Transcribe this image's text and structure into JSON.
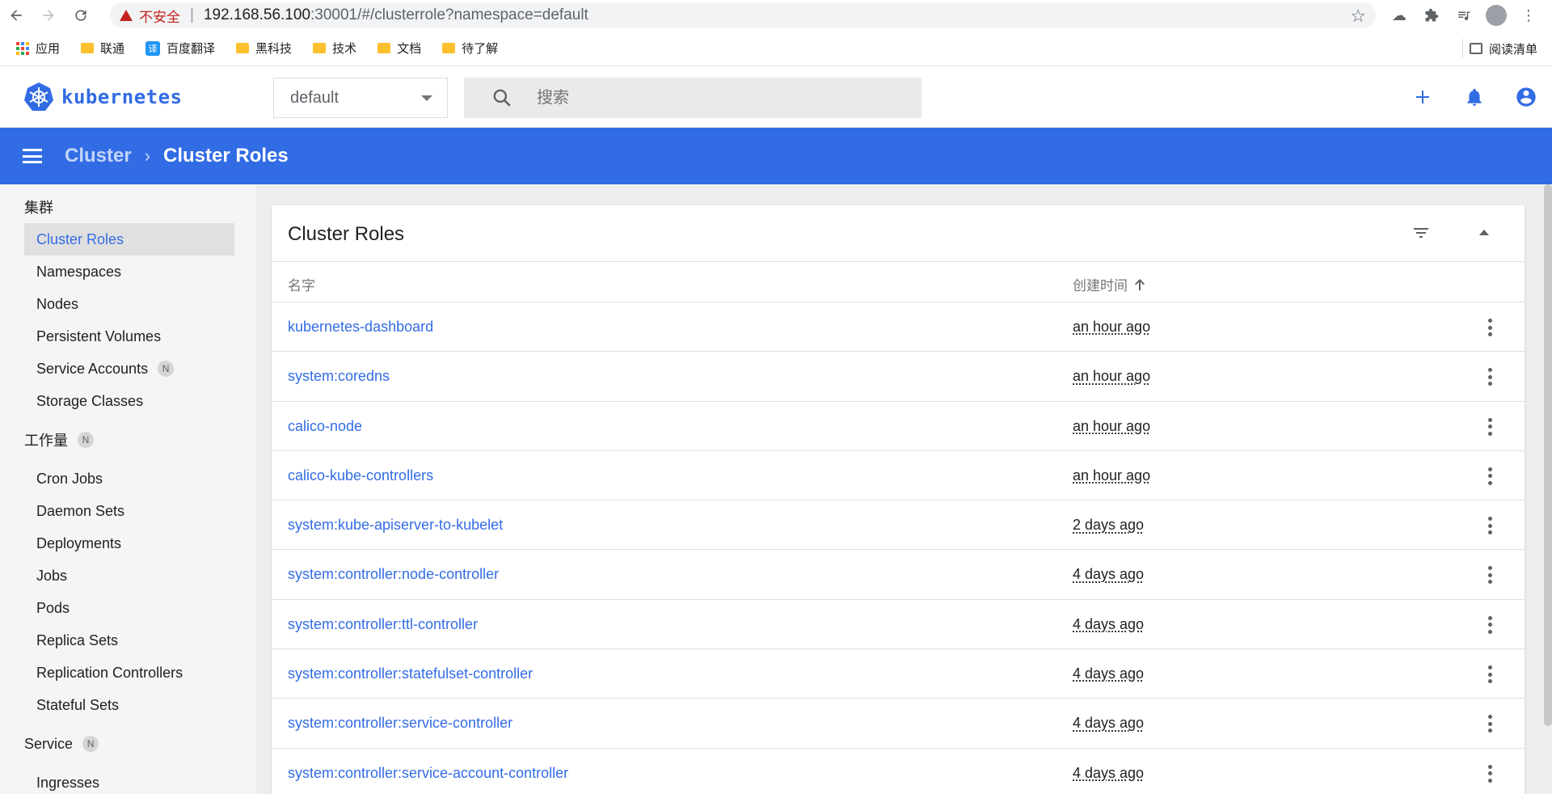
{
  "browser": {
    "warning": "不安全",
    "url_host": "192.168.56.100",
    "url_rest": ":30001/#/clusterrole?namespace=default"
  },
  "bookmarks": {
    "items": [
      "应用",
      "联通",
      "百度翻译",
      "黑科技",
      "技术",
      "文档",
      "待了解"
    ],
    "fanyi_glyph": "译",
    "reading_list": "阅读清单"
  },
  "header": {
    "logo_text": "kubernetes",
    "namespace": "default",
    "search_placeholder": "搜索"
  },
  "toolbar": {
    "crumb_parent": "Cluster",
    "crumb_current": "Cluster Roles"
  },
  "sidebar": {
    "cluster_heading": "集群",
    "cluster_items": [
      "Cluster Roles",
      "Namespaces",
      "Nodes",
      "Persistent Volumes",
      "Service Accounts",
      "Storage Classes"
    ],
    "workloads_heading": "工作量",
    "workload_items": [
      "Cron Jobs",
      "Daemon Sets",
      "Deployments",
      "Jobs",
      "Pods",
      "Replica Sets",
      "Replication Controllers",
      "Stateful Sets"
    ],
    "service_heading": "Service",
    "service_items": [
      "Ingresses"
    ],
    "badge": "N"
  },
  "card": {
    "title": "Cluster Roles",
    "col_name": "名字",
    "col_created": "创建时间",
    "rows": [
      {
        "name": "kubernetes-dashboard",
        "created": "an hour ago"
      },
      {
        "name": "system:coredns",
        "created": "an hour ago"
      },
      {
        "name": "calico-node",
        "created": "an hour ago"
      },
      {
        "name": "calico-kube-controllers",
        "created": "an hour ago"
      },
      {
        "name": "system:kube-apiserver-to-kubelet",
        "created": "2 days ago"
      },
      {
        "name": "system:controller:node-controller",
        "created": "4 days ago"
      },
      {
        "name": "system:controller:ttl-controller",
        "created": "4 days ago"
      },
      {
        "name": "system:controller:statefulset-controller",
        "created": "4 days ago"
      },
      {
        "name": "system:controller:service-controller",
        "created": "4 days ago"
      },
      {
        "name": "system:controller:service-account-controller",
        "created": "4 days ago"
      }
    ]
  },
  "colors": {
    "brand": "#326ce5",
    "sidebar_bg": "#f5f5f5"
  }
}
